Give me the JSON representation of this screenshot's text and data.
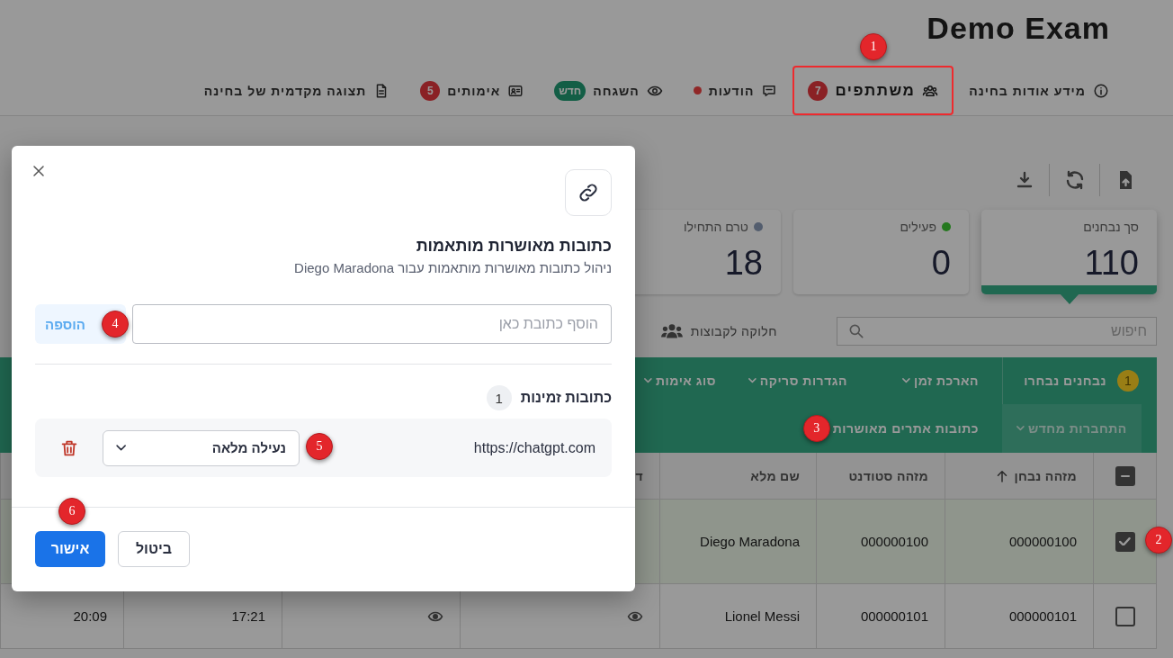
{
  "header": {
    "title": "Demo Exam"
  },
  "nav": [
    {
      "kind": "info",
      "label": "מידע אודות בחינה",
      "selected": false,
      "highlighted": false,
      "alert": false
    },
    {
      "kind": "participants",
      "label": "משתתפים",
      "badge": {
        "text": "7",
        "color": "#8a2125"
      },
      "selected": true,
      "highlighted": true,
      "alert": false,
      "marker": "1"
    },
    {
      "kind": "messages",
      "label": "הודעות",
      "selected": false,
      "highlighted": false,
      "alert": true
    },
    {
      "kind": "proctoring",
      "label": "השגחה",
      "badge": {
        "text": "חדש",
        "color": "#135e46"
      },
      "selected": false,
      "highlighted": false,
      "alert": false
    },
    {
      "kind": "verifications",
      "label": "אימותים",
      "badge": {
        "text": "5",
        "color": "#8a2125"
      },
      "selected": false,
      "highlighted": false,
      "alert": false
    },
    {
      "kind": "preview",
      "label": "תצוגה מקדמית של בחינה",
      "selected": false,
      "highlighted": false,
      "alert": false
    }
  ],
  "stats": [
    {
      "label": "סך נבחנים",
      "value": "110",
      "selected": true
    },
    {
      "label": "פעילים",
      "value": "0",
      "color": "#24781e",
      "selected": false
    },
    {
      "label": "טרם התחילו",
      "value": "18",
      "color": "#535d6e",
      "selected": false
    }
  ],
  "filter": {
    "search_placeholder": "חיפוש",
    "group_label": "חלוקה לקבוצות"
  },
  "action_bar": {
    "selection_count": "1",
    "selection_label": "נבחנים נבחרו",
    "actions": [
      {
        "label": "הארכת זמן",
        "kind": "dropdown",
        "disabled": false
      },
      {
        "label": "הגדרות סריקה",
        "kind": "dropdown",
        "disabled": false
      },
      {
        "label": "סוג אימות",
        "kind": "dropdown",
        "disabled": false
      },
      {
        "label": "התחברות מחדש",
        "kind": "dropdown",
        "disabled": true
      },
      {
        "label": "כתובות אתרים מאושרות",
        "kind": "link",
        "disabled": false,
        "marker": "3"
      }
    ]
  },
  "table": {
    "select_all": {
      "partial": true
    },
    "columns": [
      {
        "label": "מזהה נבחן",
        "sorted": true
      },
      {
        "label": "מזהה סטודנט",
        "sorted": false
      },
      {
        "label": "שם מלא",
        "sorted": false
      },
      {
        "label": "ד",
        "sorted": false
      }
    ],
    "rows": [
      {
        "selected": true,
        "marker": "2",
        "cells": [
          {
            "kind": "text",
            "text": "000000100"
          },
          {
            "kind": "text",
            "text": "000000100"
          },
          {
            "kind": "text",
            "text": "Diego Maradona"
          }
        ]
      },
      {
        "selected": false,
        "cells": [
          {
            "kind": "text",
            "text": "000000101"
          },
          {
            "kind": "text",
            "text": "000000101"
          },
          {
            "kind": "text",
            "text": "Lionel Messi"
          },
          {
            "kind": "view"
          },
          {
            "kind": "view"
          },
          {
            "kind": "text",
            "text": "17:21"
          },
          {
            "kind": "text",
            "text": "20:09"
          }
        ]
      }
    ]
  },
  "dialog": {
    "title": "כתובות מאושרות מותאמות",
    "subtitle": "ניהול כתובות מאושרות מותאמות עבור Diego Maradona",
    "input_placeholder": "הוסף כתובת כאן",
    "add_label": "הוספה",
    "add_disabled": true,
    "add_marker": "4",
    "section_title": "כתובות זמינות",
    "section_count": "1",
    "entries": [
      {
        "url": "https://chatgpt.com",
        "mode": "נעילה מלאה",
        "marker": "5"
      }
    ],
    "cancel_label": "ביטול",
    "confirm_label": "אישור",
    "confirm_marker": "6"
  }
}
